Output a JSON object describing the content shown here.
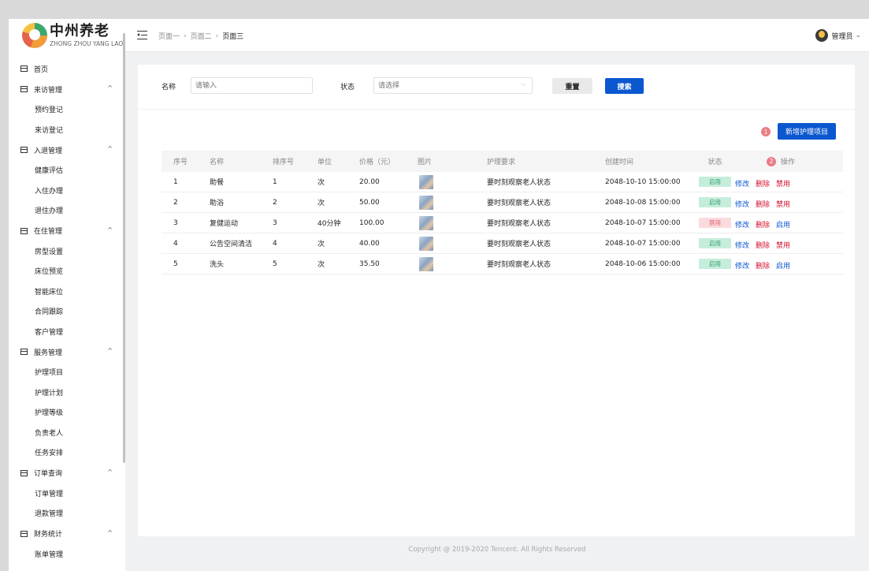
{
  "brand": {
    "name": "中州养老",
    "sub": "ZHONG ZHOU YANG LAO"
  },
  "header": {
    "breadcrumbs": [
      "页面一",
      "页面二",
      "页面三"
    ],
    "separator": "›",
    "user": "管理员",
    "user_caret": "⌄"
  },
  "sidebar": {
    "caret": "^",
    "sections": [
      {
        "label": "首页",
        "items": []
      },
      {
        "label": "来访管理",
        "items": [
          "预约登记",
          "来访登记"
        ]
      },
      {
        "label": "入退管理",
        "items": [
          "健康评估",
          "入住办理",
          "退住办理"
        ]
      },
      {
        "label": "在住管理",
        "items": [
          "房型设置",
          "床位预览",
          "智能床位",
          "合同跟踪",
          "客户管理"
        ]
      },
      {
        "label": "服务管理",
        "items": [
          "护理项目",
          "护理计划",
          "护理等级",
          "负责老人",
          "任务安排"
        ]
      },
      {
        "label": "订单查询",
        "items": [
          "订单管理",
          "退款管理"
        ]
      },
      {
        "label": "财务统计",
        "items": [
          "账单管理"
        ]
      }
    ]
  },
  "filters": {
    "name_label": "名称",
    "name_placeholder": "请输入",
    "status_label": "状态",
    "status_placeholder": "请选择",
    "select_arrow": "⌵",
    "reset": "重置",
    "search": "搜索"
  },
  "actions": {
    "add": "新增护理项目",
    "badge1": "1",
    "badge2": "2"
  },
  "table": {
    "columns": [
      "序号",
      "名称",
      "排序号",
      "单位",
      "价格（元）",
      "图片",
      "护理要求",
      "创建时间",
      "状态",
      "操作"
    ],
    "rows": [
      {
        "no": "1",
        "name": "助餐",
        "order": "1",
        "unit": "次",
        "price": "20.00",
        "req": "要时刻观察老人状态",
        "time": "2048-10-10 15:00:00",
        "status": "启用",
        "toggle": "禁用"
      },
      {
        "no": "2",
        "name": "助浴",
        "order": "2",
        "unit": "次",
        "price": "50.00",
        "req": "要时刻观察老人状态",
        "time": "2048-10-08 15:00:00",
        "status": "启用",
        "toggle": "禁用"
      },
      {
        "no": "3",
        "name": "复健运动",
        "order": "3",
        "unit": "40分钟",
        "price": "100.00",
        "req": "要时刻观察老人状态",
        "time": "2048-10-07 15:00:00",
        "status": "禁用",
        "toggle": "启用"
      },
      {
        "no": "4",
        "name": "公告空间清洁",
        "order": "4",
        "unit": "次",
        "price": "40.00",
        "req": "要时刻观察老人状态",
        "time": "2048-10-07 15:00:00",
        "status": "启用",
        "toggle": "禁用"
      },
      {
        "no": "5",
        "name": "洗头",
        "order": "5",
        "unit": "次",
        "price": "35.50",
        "req": "要时刻观察老人状态",
        "time": "2048-10-06 15:00:00",
        "status": "启用",
        "toggle": "启用"
      }
    ],
    "edit": "修改",
    "delete": "删除"
  },
  "footer": "Copyright @ 2019-2020 Tencent. All Rights Reserved",
  "colors": {
    "primary": "#0b57d0",
    "danger": "#d4102e",
    "enabled_bg": "#c6eddb",
    "enabled_text": "#2f9e6a",
    "disabled_bg": "#fadadd",
    "disabled_text": "#e0606f",
    "badge": "#e87d86"
  }
}
